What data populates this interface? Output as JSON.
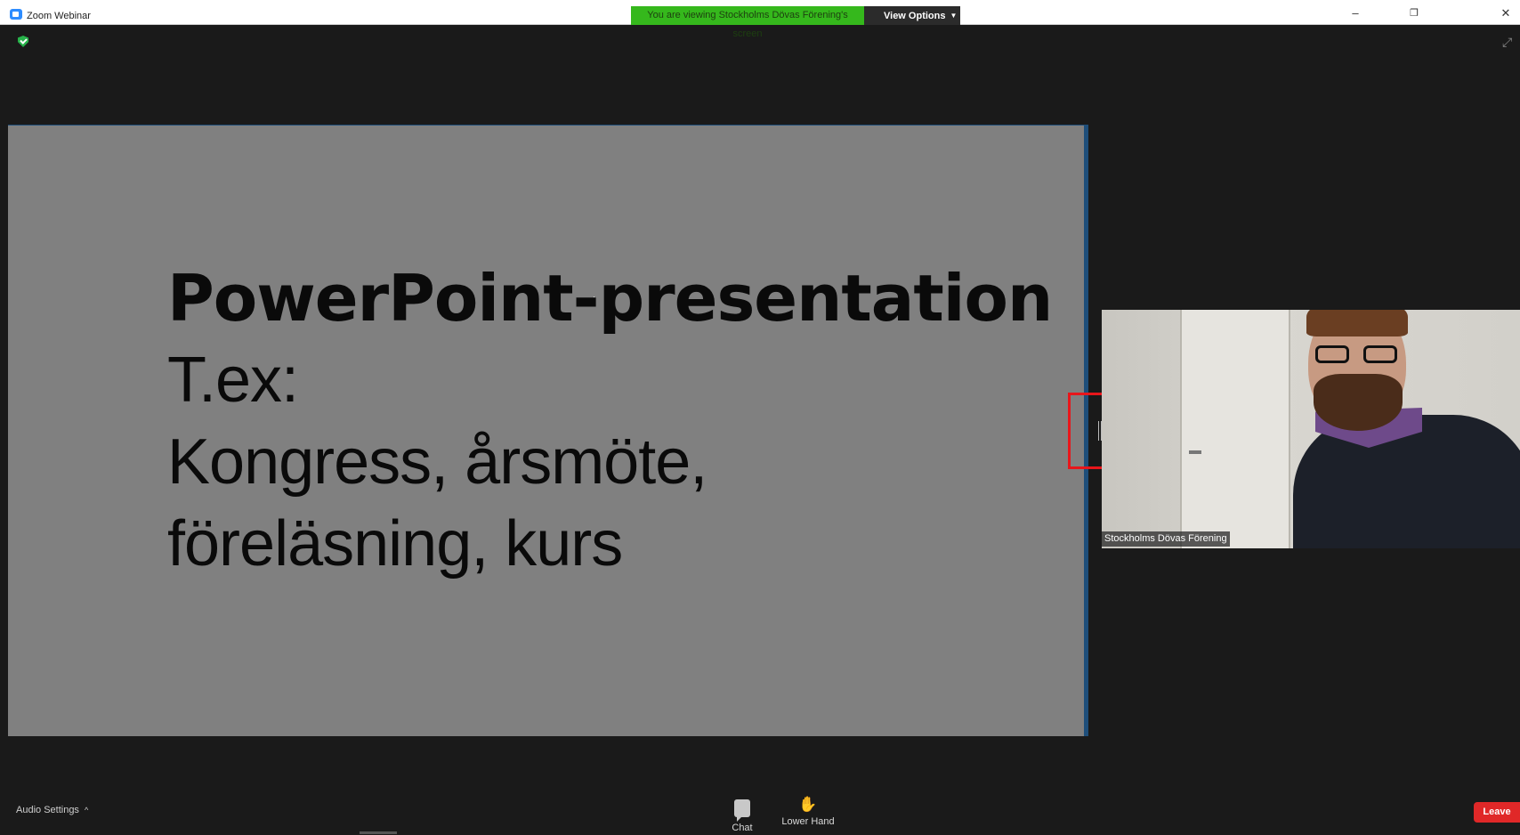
{
  "window": {
    "title": "Zoom Webinar",
    "controls": {
      "minimize": "–",
      "restore": "❐",
      "close": "✕"
    }
  },
  "share_banner": {
    "viewing_text": "You are viewing Stockholms Dövas Förening's screen",
    "view_options_label": "View Options",
    "colors": {
      "banner": "#35b81c",
      "options_bg": "#2b2b2b"
    }
  },
  "slide": {
    "lines": [
      "PowerPoint-presentation",
      "T.ex:",
      "Kongress, årsmöte,",
      "föreläsning, kurs"
    ],
    "background_color": "#808080"
  },
  "video": {
    "participant_name": "Stockholms Dövas Förening"
  },
  "toolbar": {
    "audio_settings_label": "Audio Settings",
    "chat_label": "Chat",
    "lower_hand_label": "Lower Hand",
    "leave_label": "Leave",
    "leave_color": "#e02828",
    "hand_color": "#3b8cf0"
  },
  "icons": {
    "shield": "shield-icon",
    "expand": "expand-icon",
    "chat": "chat-icon",
    "hand": "hand-icon",
    "app": "zoom-app-icon"
  }
}
